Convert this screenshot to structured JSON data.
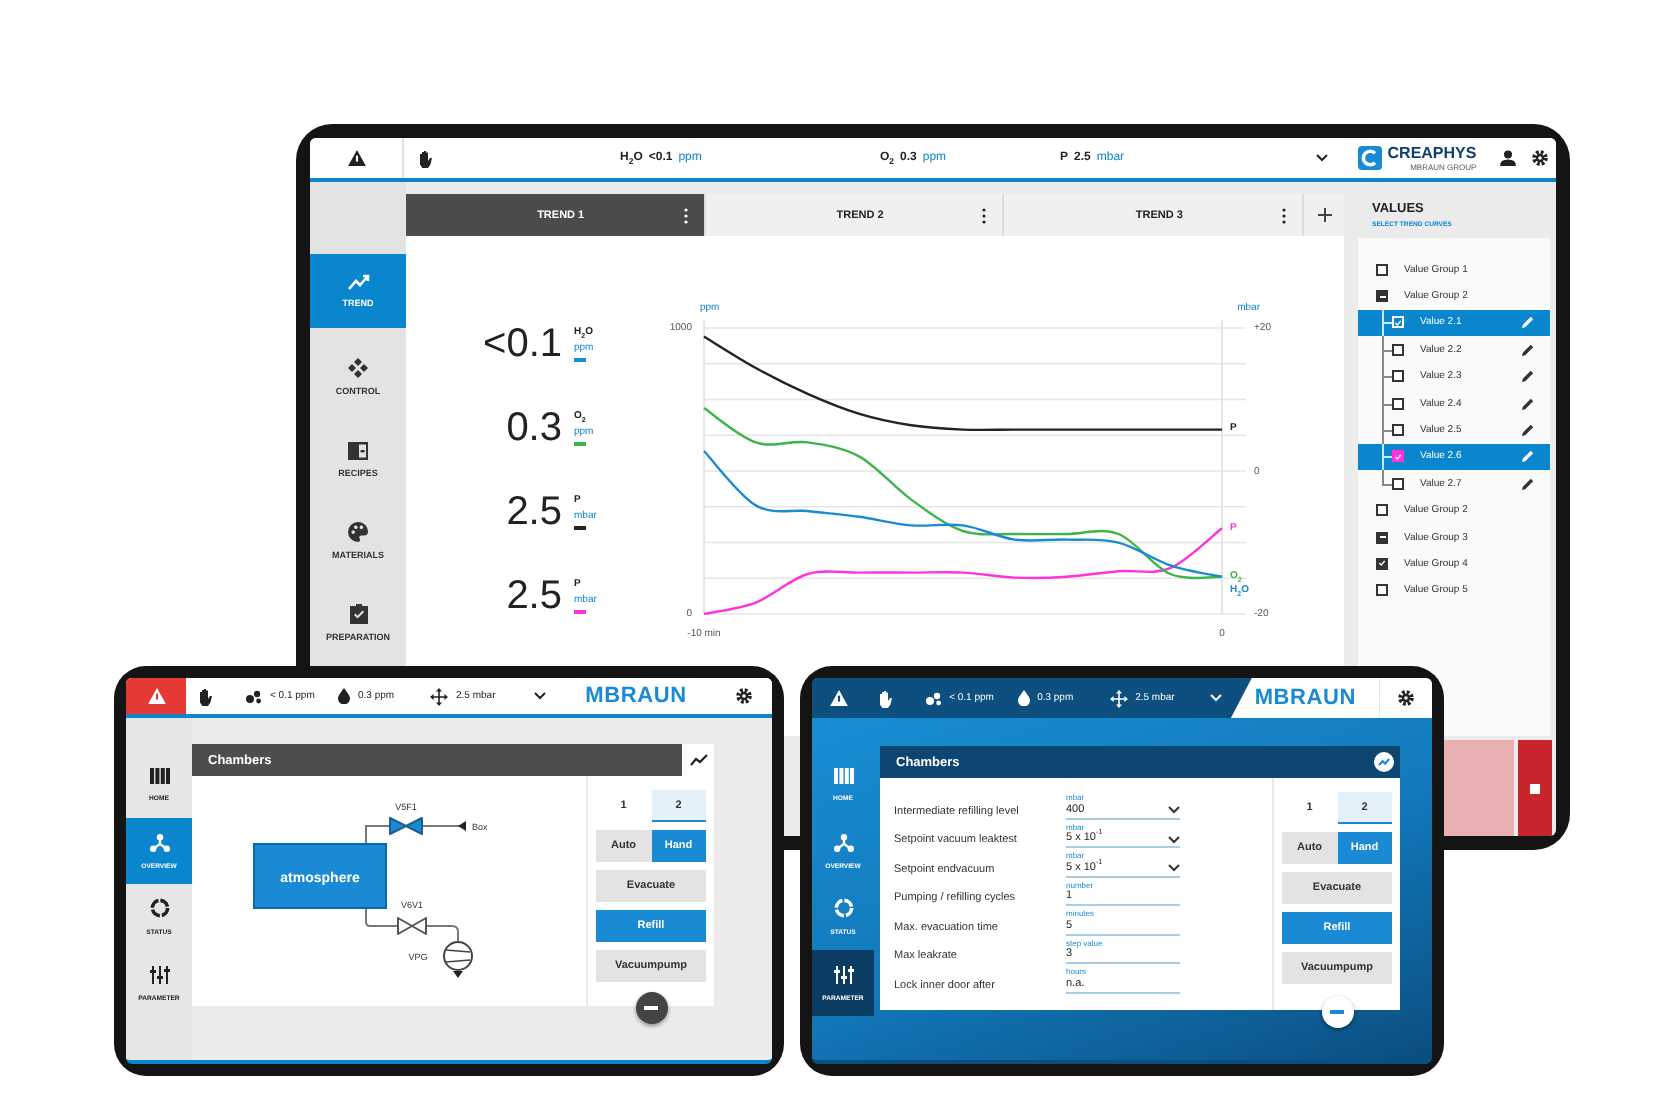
{
  "main_tablet": {
    "top_bar": {
      "readings": [
        {
          "label": "H$_{2}$O",
          "value": "<0.1",
          "unit": "ppm"
        },
        {
          "label": "O$_{2}$",
          "value": "0.3",
          "unit": "ppm"
        },
        {
          "label": "P",
          "value": "2.5",
          "unit": "mbar"
        }
      ],
      "logo": {
        "name": "CREAPHYS",
        "tagline": "MBRAUN GROUP"
      }
    },
    "sidebar": {
      "items": [
        {
          "label": "TREND",
          "selected": true
        },
        {
          "label": "CONTROL",
          "selected": false
        },
        {
          "label": "RECIPES",
          "selected": false
        },
        {
          "label": "MATERIALS",
          "selected": false
        },
        {
          "label": "PREPARATION",
          "selected": false
        }
      ]
    },
    "tabs": [
      {
        "label": "TREND 1",
        "selected": true
      },
      {
        "label": "TREND 2",
        "selected": false
      },
      {
        "label": "TREND 3",
        "selected": false
      }
    ],
    "readouts": [
      {
        "value": "<0.1",
        "label": "H$_{2}$O",
        "unit": "ppm",
        "color": "#1a8ad4"
      },
      {
        "value": "0.3",
        "label": "O$_{2}$",
        "unit": "ppm",
        "color": "#3cb54a"
      },
      {
        "value": "2.5",
        "label": "P",
        "unit": "mbar",
        "color": "#222222"
      },
      {
        "value": "2.5",
        "label": "P",
        "unit": "mbar",
        "color": "#ff33dd"
      }
    ],
    "chart": {
      "left_unit": "ppm",
      "right_unit": "mbar",
      "right_ticks": [
        "+20",
        "0",
        "-20"
      ],
      "chart_data": {
        "type": "line",
        "x": [
          -10,
          -9,
          -8,
          -7,
          -6,
          -5,
          -4,
          -3,
          -2,
          -1,
          0
        ],
        "xlim": [
          -10,
          0
        ],
        "xticks": [
          {
            "value": -10,
            "label": "-10 min"
          },
          {
            "value": 0,
            "label": "0"
          }
        ],
        "ylim": [
          0,
          1000
        ],
        "yticks": [
          0,
          1000
        ],
        "series": [
          {
            "name": "P",
            "color": "#222222",
            "values": [
              970,
              860,
              770,
              700,
              660,
              645,
              645,
              645,
              645,
              645,
              645
            ]
          },
          {
            "name": "P",
            "color": "#ff33dd",
            "values": [
              0,
              40,
              140,
              145,
              145,
              145,
              127,
              130,
              150,
              160,
              300
            ]
          },
          {
            "name": "O$_{2}$",
            "color": "#3cb54a",
            "values": [
              720,
              600,
              600,
              550,
              400,
              290,
              280,
              280,
              280,
              140,
              130
            ]
          },
          {
            "name": "H$_{2}$O",
            "color": "#1a8ad4",
            "values": [
              570,
              380,
              360,
              340,
              310,
              310,
              260,
              260,
              250,
              170,
              130
            ]
          }
        ]
      }
    },
    "values_panel": {
      "title": "VALUES",
      "subtitle": "SELECT TREND CURVES",
      "items": [
        {
          "label": "Value Group 1",
          "checked": false,
          "partial": false,
          "selected": false
        },
        {
          "label": "Value Group 2",
          "checked": false,
          "partial": true,
          "selected": false,
          "children": [
            {
              "label": "Value 2.1",
              "checked": true,
              "selected": true
            },
            {
              "label": "Value 2.2",
              "checked": false,
              "selected": false
            },
            {
              "label": "Value 2.3",
              "checked": false,
              "selected": false
            },
            {
              "label": "Value 2.4",
              "checked": false,
              "selected": false
            },
            {
              "label": "Value 2.5",
              "checked": false,
              "selected": false
            },
            {
              "label": "Value 2.6",
              "checked": true,
              "selected": true,
              "color": "#ff33dd"
            },
            {
              "label": "Value 2.7",
              "checked": false,
              "selected": false
            }
          ]
        },
        {
          "label": "Value Group 2",
          "checked": false,
          "partial": false,
          "selected": false
        },
        {
          "label": "Value Group 3",
          "checked": false,
          "partial": true,
          "selected": false
        },
        {
          "label": "Value Group 4",
          "checked": true,
          "partial": false,
          "selected": false
        },
        {
          "label": "Value Group 5",
          "checked": false,
          "partial": false,
          "selected": false
        }
      ]
    }
  },
  "left_tablet": {
    "top_bar": {
      "alarm": true,
      "readings": [
        "< 0.1 ppm",
        "0.3 ppm",
        "2.5 mbar"
      ],
      "logo": "MBRAUN"
    },
    "sidebar": {
      "items": [
        {
          "label": "HOME",
          "selected": false
        },
        {
          "label": "OVERVIEW",
          "selected": true
        },
        {
          "label": "STATUS",
          "selected": false
        },
        {
          "label": "PARAMETER",
          "selected": false
        }
      ]
    },
    "panel": {
      "title": "Chambers",
      "kind": "diagram",
      "diagram": {
        "tank": "atmosphere",
        "valves": [
          {
            "label": "V5F1",
            "open": true
          },
          {
            "label": "V6V1",
            "open": false
          }
        ],
        "pump": "VPG",
        "inlet": "Box"
      }
    },
    "controls": {
      "chambers": [
        {
          "label": "1",
          "selected": false
        },
        {
          "label": "2",
          "selected": true
        }
      ],
      "modes": [
        {
          "label": "Auto",
          "selected": false
        },
        {
          "label": "Hand",
          "selected": true
        }
      ],
      "actions": [
        {
          "label": "Evacuate",
          "active": false
        },
        {
          "label": "Refill",
          "active": true
        },
        {
          "label": "Vacuumpump",
          "active": false
        }
      ]
    }
  },
  "right_tablet": {
    "top_bar": {
      "alarm": false,
      "readings": [
        "< 0.1 ppm",
        "0.3 ppm",
        "2.5 mbar"
      ],
      "logo": "MBRAUN"
    },
    "sidebar": {
      "items": [
        {
          "label": "HOME",
          "selected": false
        },
        {
          "label": "OVERVIEW",
          "selected": false
        },
        {
          "label": "STATUS",
          "selected": false
        },
        {
          "label": "PARAMETER",
          "selected": true
        }
      ]
    },
    "panel": {
      "title": "Chambers",
      "kind": "parameters",
      "parameters": [
        {
          "label": "Intermediate refilling level",
          "unit": "mbar",
          "value": "400",
          "dropdown": true
        },
        {
          "label": "Setpoint vacuum leaktest",
          "unit": "mbar",
          "value": "5 x 10$^{-1}$",
          "dropdown": true
        },
        {
          "label": "Setpoint endvacuum",
          "unit": "mbar",
          "value": "5 x 10$^{-1}$",
          "dropdown": true
        },
        {
          "label": "Pumping / refilling cycles",
          "unit": "number",
          "value": "1",
          "dropdown": false
        },
        {
          "label": "Max. evacuation time",
          "unit": "minutes",
          "value": "5",
          "dropdown": false
        },
        {
          "label": "Max leakrate",
          "unit": "step value",
          "value": "3",
          "dropdown": false
        },
        {
          "label": "Lock inner door after",
          "unit": "hours",
          "value": "n.a.",
          "dropdown": false
        }
      ]
    },
    "controls": {
      "chambers": [
        {
          "label": "1",
          "selected": false
        },
        {
          "label": "2",
          "selected": true
        }
      ],
      "modes": [
        {
          "label": "Auto",
          "selected": false
        },
        {
          "label": "Hand",
          "selected": true
        }
      ],
      "actions": [
        {
          "label": "Evacuate",
          "active": false
        },
        {
          "label": "Refill",
          "active": true
        },
        {
          "label": "Vacuumpump",
          "active": false
        }
      ]
    }
  }
}
